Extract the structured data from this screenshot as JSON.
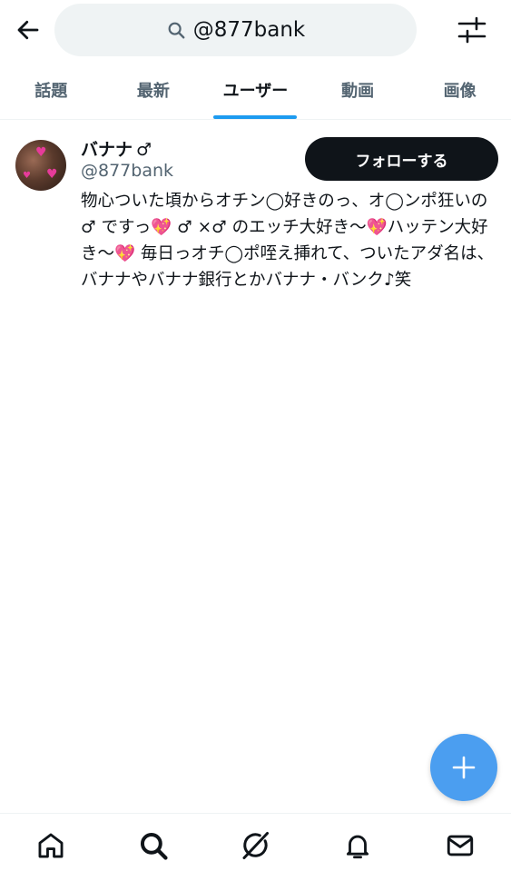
{
  "header": {
    "search_query": "@877bank",
    "back_icon": "back-arrow-icon",
    "search_icon": "search-icon",
    "filter_icon": "filter-sliders-icon"
  },
  "tabs": [
    {
      "label": "話題",
      "active": false
    },
    {
      "label": "最新",
      "active": false
    },
    {
      "label": "ユーザー",
      "active": true
    },
    {
      "label": "動画",
      "active": false
    },
    {
      "label": "画像",
      "active": false
    }
  ],
  "user": {
    "display_name": "バナナ",
    "name_emoji": "♂",
    "handle": "@877bank",
    "follow_label": "フォローする",
    "bio": "物心ついた頃からオチン◯好きのっ、オ◯ンポ狂いの♂ ですっ💖 ♂ ×♂ のエッチ大好き〜💖ハッテン大好き〜💖 毎日っオチ◯ポ咥え挿れて、ついたアダ名は、バナナやバナナ銀行とかバナナ・バンク♪笑"
  },
  "fab": {
    "icon": "plus-icon"
  },
  "bottom_nav": [
    {
      "name": "home",
      "icon": "home-icon"
    },
    {
      "name": "search",
      "icon": "search-icon"
    },
    {
      "name": "grok",
      "icon": "grok-icon"
    },
    {
      "name": "notifications",
      "icon": "bell-icon"
    },
    {
      "name": "messages",
      "icon": "mail-icon"
    }
  ],
  "colors": {
    "accent": "#1d9bf0",
    "fab": "#4b9ef0",
    "text_primary": "#0f1419",
    "text_secondary": "#536471",
    "search_bg": "#eff3f4"
  }
}
